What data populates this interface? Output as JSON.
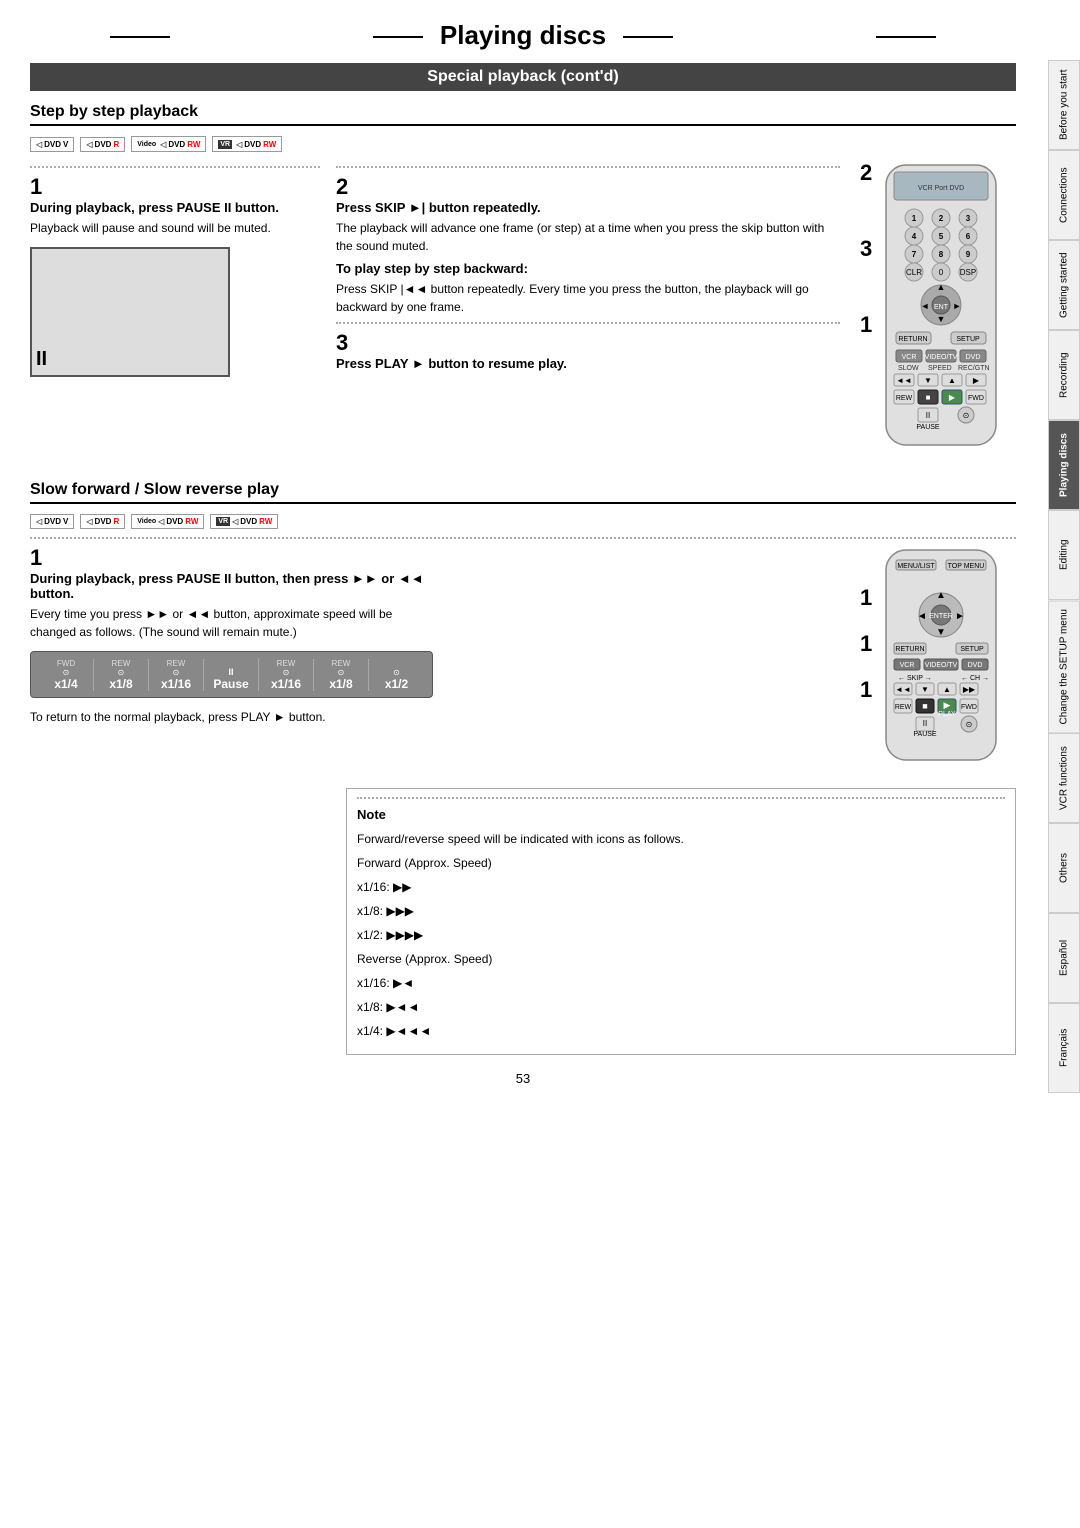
{
  "page": {
    "title": "Playing discs",
    "section_header": "Special playback (cont'd)",
    "page_number": "53"
  },
  "tabs": [
    {
      "id": "before-you-start",
      "label": "Before you start",
      "active": false
    },
    {
      "id": "connections",
      "label": "Connections",
      "active": false
    },
    {
      "id": "getting-started",
      "label": "Getting started",
      "active": false
    },
    {
      "id": "recording",
      "label": "Recording",
      "active": false
    },
    {
      "id": "playing-discs",
      "label": "Playing discs",
      "active": true
    },
    {
      "id": "editing",
      "label": "Editing",
      "active": false
    },
    {
      "id": "change-setup",
      "label": "Change the SETUP menu",
      "active": false
    },
    {
      "id": "vcr-functions",
      "label": "VCR functions",
      "active": false
    },
    {
      "id": "others",
      "label": "Others",
      "active": false
    },
    {
      "id": "espanol",
      "label": "Español",
      "active": false
    },
    {
      "id": "francais",
      "label": "Français",
      "active": false
    }
  ],
  "step_by_step": {
    "title": "Step by step playback",
    "disc_logos": [
      "DVD-V",
      "DVD-R",
      "Video DVD-RW",
      "VR DVD-RW"
    ],
    "step1": {
      "number": "1",
      "instruction_bold": "During playback, press PAUSE II button.",
      "instruction_normal": "Playback will pause and sound will be muted."
    },
    "step2": {
      "number": "2",
      "instruction_bold": "Press SKIP ►| button repeatedly.",
      "instruction_normal": "The playback will advance one frame (or step) at a time when you press the skip button with the sound muted."
    },
    "step3_back": {
      "title": "To play step by step backward:",
      "instruction": "Press SKIP |◄◄ button repeatedly. Every time you press the button, the playback will go backward by one frame."
    },
    "step3": {
      "number": "3",
      "instruction_bold": "Press PLAY ► button to resume play."
    }
  },
  "slow_section": {
    "title": "Slow forward / Slow reverse play",
    "disc_logos": [
      "DVD-V",
      "DVD-R",
      "Video DVD-RW",
      "VR DVD-RW"
    ],
    "step1_bold": "During playback, press PAUSE II button, then press ►► or ◄◄ button.",
    "step1_normal": "Every time you press ►► or ◄◄ button, approximate speed will be changed as follows. (The sound will remain mute.)",
    "speed_items": [
      {
        "label": "x1/4",
        "arrows": "⊙",
        "sublabel": "FWD"
      },
      {
        "label": "x1/8",
        "arrows": "⊙",
        "sublabel": "REW"
      },
      {
        "label": "x1/16",
        "arrows": "⊙",
        "sublabel": "REW"
      },
      {
        "label": "Pause",
        "arrows": "",
        "sublabel": ""
      },
      {
        "label": "x1/16",
        "arrows": "⊙",
        "sublabel": "REW"
      },
      {
        "label": "x1/8",
        "arrows": "⊙",
        "sublabel": "REW"
      },
      {
        "label": "x1/2",
        "arrows": "⊙",
        "sublabel": ""
      }
    ],
    "return_note": "To return to the normal playback, press PLAY ► button."
  },
  "note": {
    "title": "Note",
    "bullet1": "Forward/reverse speed will be indicated with icons as follows.",
    "forward_label": "Forward (Approx. Speed)",
    "forward_speeds": [
      "x1/16: ▶▶",
      "x1/8: ▶▶▶",
      "x1/2: ▶▶▶▶"
    ],
    "reverse_label": "Reverse (Approx. Speed)",
    "reverse_speeds": [
      "x1/16: ▶◄",
      "x1/8: ▶◄◄",
      "x1/4: ▶◄◄◄"
    ]
  }
}
